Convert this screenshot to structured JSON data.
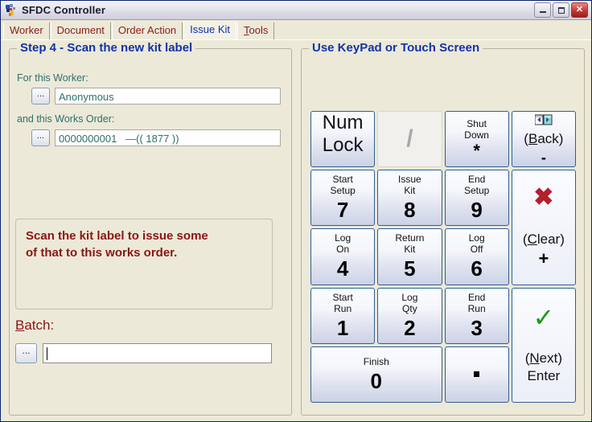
{
  "window": {
    "title": "SFDC Controller",
    "icon": "app-icon",
    "buttons": {
      "minimize": "minimize",
      "maximize": "maximize",
      "close": "close"
    }
  },
  "tabs": [
    {
      "label": "Worker",
      "active": false
    },
    {
      "label": "Document",
      "active": false
    },
    {
      "label": "Order Action",
      "active": false
    },
    {
      "label": "Issue Kit",
      "active": true
    },
    {
      "label": "Tools",
      "active": false,
      "accel": "T"
    }
  ],
  "left_panel": {
    "title": "Step 4 - Scan the new kit label",
    "worker": {
      "label": "For this Worker:",
      "browse_label": "...",
      "value": "Anonymous"
    },
    "works_order": {
      "label": "and this Works Order:",
      "browse_label": "...",
      "value": "0000000001   —(( 1877 ))"
    },
    "message": "Scan the kit label to issue some\nof that to this works order.",
    "batch": {
      "label_before": "B",
      "label_after": "atch:",
      "browse_label": "...",
      "value": ""
    }
  },
  "right_panel": {
    "title": "Use KeyPad or Touch Screen",
    "keys": [
      {
        "id": "numlock",
        "top": "Num\nLock",
        "sub": "...",
        "style": "word",
        "disabled": false
      },
      {
        "id": "slash",
        "glyph": "/",
        "style": "slash",
        "disabled": true
      },
      {
        "id": "shutdown",
        "top": "Shut\nDown",
        "sym": "*",
        "disabled": false
      },
      {
        "id": "back",
        "icon": "back-window-icon",
        "word": "(Back)",
        "accel": "B",
        "minus": "-",
        "disabled": false
      },
      {
        "id": "key7",
        "top": "Start\nSetup",
        "digit": "7",
        "disabled": false
      },
      {
        "id": "key8",
        "top": "Issue\nKit",
        "digit": "8",
        "disabled": false
      },
      {
        "id": "key9",
        "top": "End\nSetup",
        "digit": "9",
        "disabled": false
      },
      {
        "id": "clear",
        "icon": "x-mark-icon",
        "word": "(Clear)",
        "accel": "C",
        "plus": "+",
        "disabled": false
      },
      {
        "id": "key4",
        "top": "Log\nOn",
        "digit": "4",
        "disabled": false
      },
      {
        "id": "key5",
        "top": "Return\nKit",
        "digit": "5",
        "disabled": false
      },
      {
        "id": "key6",
        "top": "Log\nOff",
        "digit": "6",
        "disabled": false
      },
      {
        "id": "key1",
        "top": "Start\nRun",
        "digit": "1",
        "disabled": false
      },
      {
        "id": "key2",
        "top": "Log\nQty",
        "digit": "2",
        "disabled": false
      },
      {
        "id": "key3",
        "top": "End\nRun",
        "digit": "3",
        "disabled": false
      },
      {
        "id": "enter",
        "icon": "check-mark-icon",
        "word": "(Next)",
        "accel": "N",
        "word2": "Enter",
        "disabled": false
      },
      {
        "id": "key0",
        "top": "Finish",
        "digit": "0",
        "disabled": false
      },
      {
        "id": "dot",
        "glyph": ".",
        "style": "dot",
        "disabled": false
      }
    ],
    "key_labels": {
      "numlock_top": "Num",
      "numlock_bottom": "Lock",
      "numlock_tiny": "...",
      "shutdown_line1": "Shut",
      "shutdown_line2": "Down",
      "shutdown_sym": "*",
      "back_word_open": "(",
      "back_word_accel": "B",
      "back_word_rest": "ack)",
      "back_minus": "-",
      "clear_word_open": "(",
      "clear_word_accel": "C",
      "clear_word_rest": "lear)",
      "clear_plus": "+",
      "next_word_open": "(",
      "next_word_accel": "N",
      "next_word_rest": "ext)",
      "next_word2": "Enter",
      "k7_l1": "Start",
      "k7_l2": "Setup",
      "k7_d": "7",
      "k8_l1": "Issue",
      "k8_l2": "Kit",
      "k8_d": "8",
      "k9_l1": "End",
      "k9_l2": "Setup",
      "k9_d": "9",
      "k4_l1": "Log",
      "k4_l2": "On",
      "k4_d": "4",
      "k5_l1": "Return",
      "k5_l2": "Kit",
      "k5_d": "5",
      "k6_l1": "Log",
      "k6_l2": "Off",
      "k6_d": "6",
      "k1_l1": "Start",
      "k1_l2": "Run",
      "k1_d": "1",
      "k2_l1": "Log",
      "k2_l2": "Qty",
      "k2_d": "2",
      "k3_l1": "End",
      "k3_l2": "Run",
      "k3_d": "3",
      "k0_l1": "Finish",
      "k0_d": "0",
      "slash_glyph": "/"
    }
  },
  "colors": {
    "group_title": "#1233a8",
    "field_label": "#2f6f6b",
    "field_value": "#2f6f6b",
    "message": "#8b1515",
    "tab_inactive": "#8b1a1a",
    "tab_active": "#1033a0",
    "key_border": "#2f5f94",
    "x_mark": "#b41f2e",
    "check_mark": "#1a9a1a",
    "window_bg": "#ece9d8"
  }
}
